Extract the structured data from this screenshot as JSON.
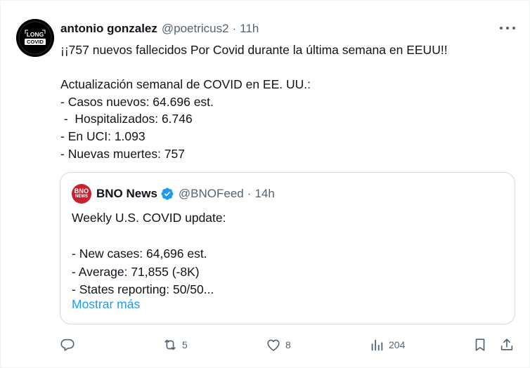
{
  "tweet": {
    "author_name": "antonio gonzalez",
    "handle": "@poetricus2",
    "separator": "·",
    "time": "11h",
    "avatar_text_top": "LONG",
    "avatar_text_bottom": "COVID",
    "text": "¡¡757 nuevos fallecidos Por Covid durante la última semana en EEUU!!\n\nActualización semanal de COVID en EE. UU.:\n- Casos nuevos: 64.696 est.\n -  Hospitalizados: 6.746\n- En UCI: 1.093\n- Nuevas muertes: 757"
  },
  "quoted_tweet": {
    "avatar_text_top": "BNO",
    "avatar_text_bottom": "NEWS",
    "author_name": "BNO News",
    "verified": true,
    "handle": "@BNOFeed",
    "separator": "·",
    "time": "14h",
    "text": "Weekly U.S. COVID update:\n\n- New cases: 64,696 est.\n- Average: 71,855 (-8K)\n- States reporting: 50/50...",
    "show_more_label": "Mostrar más"
  },
  "actions": {
    "reply_icon": "reply-icon",
    "retweet_icon": "retweet-icon",
    "retweet_count": "5",
    "like_icon": "heart-icon",
    "like_count": "8",
    "views_icon": "views-icon",
    "views_count": "204",
    "bookmark_icon": "bookmark-icon",
    "share_icon": "share-icon"
  },
  "colors": {
    "text": "#0f1419",
    "secondary": "#536471",
    "link": "#1d9bf0",
    "border": "#cfd9de",
    "verified": "#1d9bf0",
    "bno_red": "#c6232f"
  }
}
